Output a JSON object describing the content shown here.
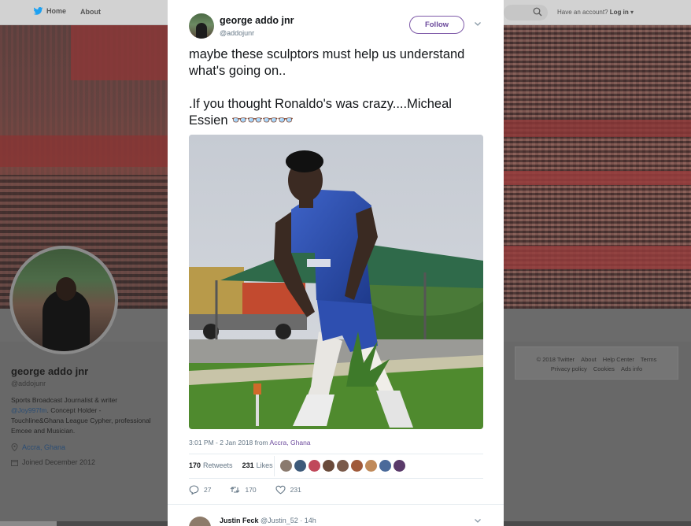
{
  "nav": {
    "home_label": "Home",
    "about_label": "About",
    "login_prompt": "Have an account?",
    "login_label": "Log in"
  },
  "profile": {
    "name": "george addo jnr",
    "handle": "@addojunr",
    "bio_before": "Sports Broadcast Journalist & writer ",
    "bio_link": "@Joy997fm",
    "bio_after": ". Concept Holder - Touchline&Ghana League Cypher, professional Emcee and Musician.",
    "location": "Accra, Ghana",
    "joined": "Joined December 2012"
  },
  "footer": {
    "row1": [
      "© 2018 Twitter",
      "About",
      "Help Center",
      "Terms"
    ],
    "row2": [
      "Privacy policy",
      "Cookies",
      "Ads info"
    ]
  },
  "tweet": {
    "name": "george addo jnr",
    "handle": "@addojunr",
    "follow_label": "Follow",
    "text_line1": "maybe these sculptors must help us understand what's going on..",
    "text_line2": ".If you thought Ronaldo's was crazy....Micheal Essien",
    "emoji": "👓👓👓👓",
    "timestamp": "3:01 PM - 2 Jan 2018 from",
    "location": "Accra, Ghana",
    "retweets_count": "170",
    "retweets_label": "Retweets",
    "likes_count": "231",
    "likes_label": "Likes",
    "reply_count": "27",
    "retweet_count": "170",
    "like_count": "231",
    "liker_colors": [
      "#8a7a6e",
      "#3d5a7a",
      "#c0485a",
      "#6a4a3a",
      "#7a5a4a",
      "#a05a3a",
      "#c08a5a",
      "#4a6a9a",
      "#5a3a6a"
    ]
  },
  "reply": {
    "name": "Justin Feck",
    "handle": "@Justin_52 · 14h"
  },
  "colors": {
    "follow_accent": "#6c4a9c",
    "link": "#6c4a9c",
    "twitter_blue": "#1da1f2"
  }
}
